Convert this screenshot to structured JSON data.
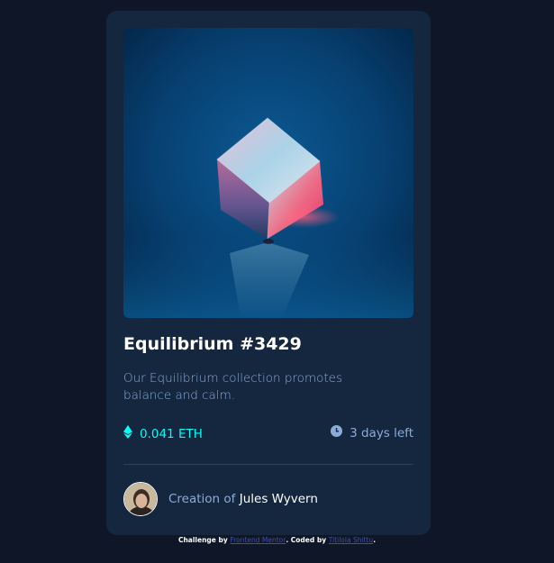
{
  "card": {
    "image_alt": "Equilibrium cube image",
    "title": "Equilibrium #3429",
    "description": "Our Equilibrium collection promotes balance and calm.",
    "price": "0.041 ETH",
    "price_icon": "ethereum-icon",
    "time_left": "3 days left",
    "time_icon": "clock-icon",
    "creator_prefix": "Creation of",
    "creator_name": "Jules Wyvern"
  },
  "attribution": {
    "challenge_by": "Challenge by",
    "frontend_mentor": "Frontend Mentor",
    "coded_by": ". Coded by",
    "author": "Titilola Shittu",
    "end": "."
  },
  "colors": {
    "background": "#0e1628",
    "card": "#15263f",
    "cyan": "#00fff8",
    "soft_blue": "#8bacd9",
    "white": "#ffffff"
  }
}
